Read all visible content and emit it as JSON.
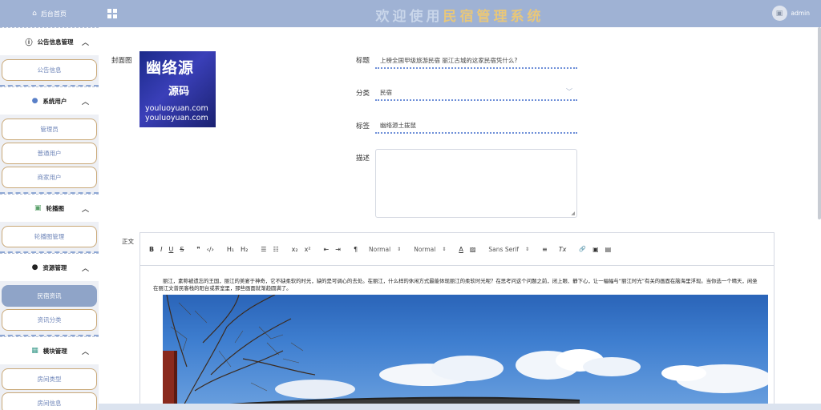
{
  "sidebar": {
    "home_label": "后台首页",
    "groups": [
      {
        "title": "公告信息管理",
        "items": [
          "公告信息"
        ]
      },
      {
        "title": "系统用户",
        "items": [
          "管理员",
          "普通用户",
          "商家用户"
        ]
      },
      {
        "title": "轮播图",
        "items": [
          "轮播图管理"
        ]
      },
      {
        "title": "资源管理",
        "items": [
          "民宿资讯",
          "资讯分类"
        ]
      },
      {
        "title": "模块管理",
        "items": [
          "房间类型",
          "房间信息"
        ]
      }
    ],
    "active_item": "民宿资讯"
  },
  "header": {
    "title_chars": [
      "欢",
      "迎",
      "使",
      "用",
      "民",
      "宿",
      "管",
      "理",
      "系",
      "统"
    ],
    "title_colors": [
      "#c9d6ea",
      "#c9d6ea",
      "#c9d6ea",
      "#c9d6ea",
      "#e8c77a",
      "#e8c77a",
      "#e8c77a",
      "#e8c77a",
      "#e8c77a",
      "#e8c77a"
    ],
    "username": "admin"
  },
  "form": {
    "cover_label": "封面图",
    "cover_text_main": "幽络源",
    "cover_text_sub": "源码",
    "cover_url_1": "youluoyuan.com",
    "cover_url_2": "youluoyuan.com",
    "title_label": "标题",
    "title_value": "上榜全国甲级旅游民宿  丽江古城的这家民宿凭什么?",
    "category_label": "分类",
    "category_value": "民宿",
    "tags_label": "标签",
    "tags_value": "幽络源土拨鼠",
    "desc_label": "描述",
    "body_label": "正文"
  },
  "editor": {
    "toolbar": {
      "bold": "B",
      "italic": "I",
      "underline": "U",
      "strike": "S",
      "quote": "❞",
      "code": "‹/›",
      "h1": "H₁",
      "h2": "H₂",
      "ol": "☰",
      "ul": "☷",
      "sub": "x₂",
      "sup": "x²",
      "outdent": "⇤",
      "indent": "⇥",
      "direction": "¶",
      "size": "Normal",
      "header": "Normal",
      "font": "Sans Serif",
      "color": "A",
      "background": "▨",
      "align": "≡",
      "clean": "Tx",
      "link": "🔗",
      "image": "▣",
      "video": "▤"
    },
    "content": "丽江，素称被遗忘的王国，丽江的美宴于神奇，它不缺柔软的时光，缺的是可调心的去处。在丽江，什么样的休闲方式最能体现丽江的柔软时光呢？在思考问这个问题之前，闭上眼、静下心，让一幅幅与“丽江时光”有关的画面在脑海里浮现。当你选一个晴天，闲坐在丽江文普民客栈的阳台或茶室里，那些画面就渐趋圆满了。"
  }
}
